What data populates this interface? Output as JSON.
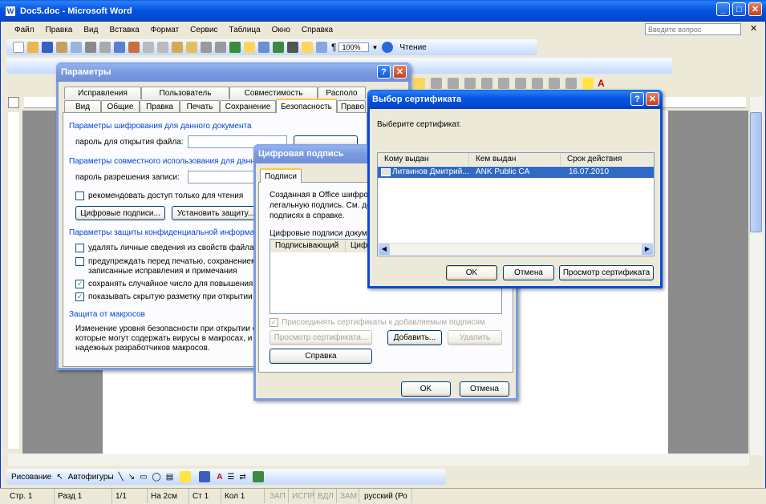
{
  "window": {
    "title": "Doc5.doc - Microsoft Word"
  },
  "menu": [
    "Файл",
    "Правка",
    "Вид",
    "Вставка",
    "Формат",
    "Сервис",
    "Таблица",
    "Окно",
    "Справка"
  ],
  "help_search": {
    "placeholder": "Введите вопрос"
  },
  "toolbar": {
    "zoom": "100%",
    "read_button": "Чтение"
  },
  "options_dialog": {
    "title": "Параметры",
    "tabs_row1": [
      "Исправления",
      "Пользователь",
      "Совместимость",
      "Располо"
    ],
    "tabs_row2": [
      "Вид",
      "Общие",
      "Правка",
      "Печать",
      "Сохранение",
      "Безопасность",
      "Право"
    ],
    "active_tab": "Безопасность",
    "group_encryption": "Параметры шифрования для данного документа",
    "open_password_label": "пароль для открытия файла:",
    "group_sharing": "Параметры совместного использования для данно",
    "write_password_label": "пароль разрешения записи:",
    "readonly_recommend": "рекомендовать доступ только для чтения",
    "digital_signatures_button": "Цифровые подписи...",
    "protect_button": "Установить защиту...",
    "group_privacy": "Параметры защиты конфиденциальной информаци",
    "privacy_options": [
      {
        "label": "удалять личные сведения из свойств файла п",
        "checked": false
      },
      {
        "label": "предупреждать перед печатью, сохранением",
        "checked": false
      },
      {
        "label": "сохранять случайное число для повышения то",
        "checked": true
      },
      {
        "label": "показывать скрытую разметку при открытии",
        "checked": true
      }
    ],
    "privacy_option2_line2": "записанные исправления и примечания",
    "group_macro": "Защита от макросов",
    "macro_text": [
      "Изменение уровня безопасности при открытии ф",
      "которые могут содержать вирусы в макросах, и у",
      "надежных разработчиков макросов."
    ]
  },
  "signature_dialog": {
    "title": "Цифровая подпись",
    "tab": "Подписи",
    "intro": [
      "Созданная в Office шифров",
      "легальную подпись. См. до",
      "подписях в справке."
    ],
    "list_label": "Цифровые подписи докуме",
    "columns": [
      "Подписывающий",
      "Циф"
    ],
    "attach_certs": "Присоединять сертификаты к добавляемым подписям",
    "view_cert_button": "Просмотр сертификата...",
    "add_button": "Добавить...",
    "remove_button": "Удалить",
    "help_button": "Справка",
    "ok_button": "OK",
    "cancel_button": "Отмена"
  },
  "cert_dialog": {
    "title": "Выбор сертификата",
    "prompt": "Выберите сертификат.",
    "columns": [
      "Кому выдан",
      "Кем выдан",
      "Срок действия"
    ],
    "rows": [
      {
        "issued_to": "Литвинов Дмитрий...",
        "issued_by": "ANK Public CA",
        "expires": "16.07.2010"
      }
    ],
    "ok_button": "OK",
    "cancel_button": "Отмена",
    "view_button": "Просмотр сертификата"
  },
  "drawing_toolbar": {
    "drawing": "Рисование",
    "autoshapes": "Автофигуры"
  },
  "status_bar": {
    "page": "Стр. 1",
    "section": "Разд 1",
    "pages": "1/1",
    "at": "На 2см",
    "line": "Ст 1",
    "col": "Кол 1",
    "modes": [
      "ЗАП",
      "ИСПР",
      "ВДЛ",
      "ЗАМ"
    ],
    "language": "русский (Ро"
  }
}
